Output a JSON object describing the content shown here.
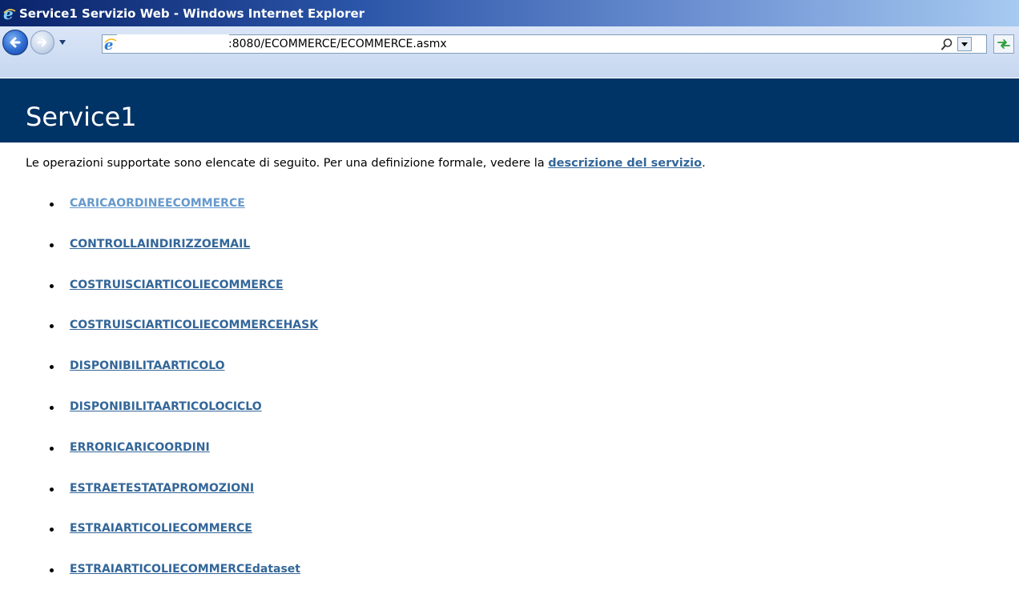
{
  "window": {
    "title": "Service1 Servizio Web - Windows Internet Explorer"
  },
  "navbar": {
    "address": ":8080/ECOMMERCE/ECOMMERCE.asmx"
  },
  "page": {
    "title": "Service1",
    "intro_text": "Le operazioni supportate sono elencate di seguito. Per una definizione formale, vedere la ",
    "intro_link": "descrizione del servizio",
    "intro_end": "."
  },
  "operations": [
    {
      "label": "CARICAORDINEECOMMERCE"
    },
    {
      "label": "CONTROLLAINDIRIZZOEMAIL"
    },
    {
      "label": "COSTRUISCIARTICOLIECOMMERCE"
    },
    {
      "label": "COSTRUISCIARTICOLIECOMMERCEHASK"
    },
    {
      "label": "DISPONIBILITAARTICOLO"
    },
    {
      "label": "DISPONIBILITAARTICOLOCICLO"
    },
    {
      "label": "ERRORICARICOORDINI"
    },
    {
      "label": "ESTRAETESTATAPROMOZIONI"
    },
    {
      "label": "ESTRAIARTICOLIECOMMERCE"
    },
    {
      "label": "ESTRAIARTICOLIECOMMERCEdataset"
    }
  ],
  "colors": {
    "header_bg": "#003366",
    "link": "#336699",
    "link_highlight": "#6699cc"
  },
  "icons": {
    "window_icon": "ie-logo-icon",
    "back": "back-arrow-icon",
    "forward": "forward-arrow-icon",
    "search": "search-icon",
    "refresh": "refresh-icon"
  }
}
